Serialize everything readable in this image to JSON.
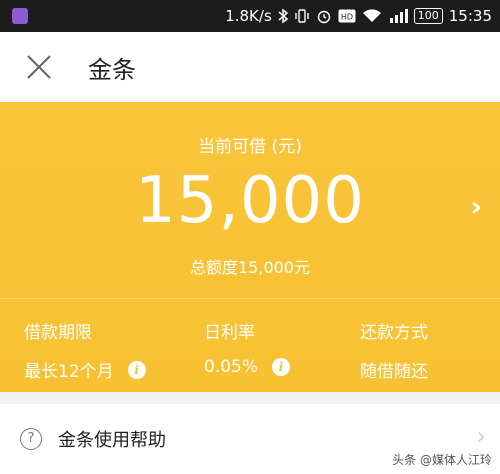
{
  "status_bar": {
    "speed": "1.8K/s",
    "battery": "100",
    "time": "15:35"
  },
  "header": {
    "title": "金条"
  },
  "loan": {
    "available_label": "当前可借 (元)",
    "available_amount": "15,000",
    "total_limit_text": "总额度15,000元",
    "term_label": "借款期限",
    "term_value": "最长12个月",
    "rate_label": "日利率",
    "rate_value": "0.05%",
    "repay_label": "还款方式",
    "repay_value": "随借随还"
  },
  "help": {
    "label": "金条使用帮助"
  },
  "watermark": "头条 @媒体人江玲",
  "colors": {
    "accent": "#f7c132",
    "status_bar": "#1c1c1c"
  }
}
